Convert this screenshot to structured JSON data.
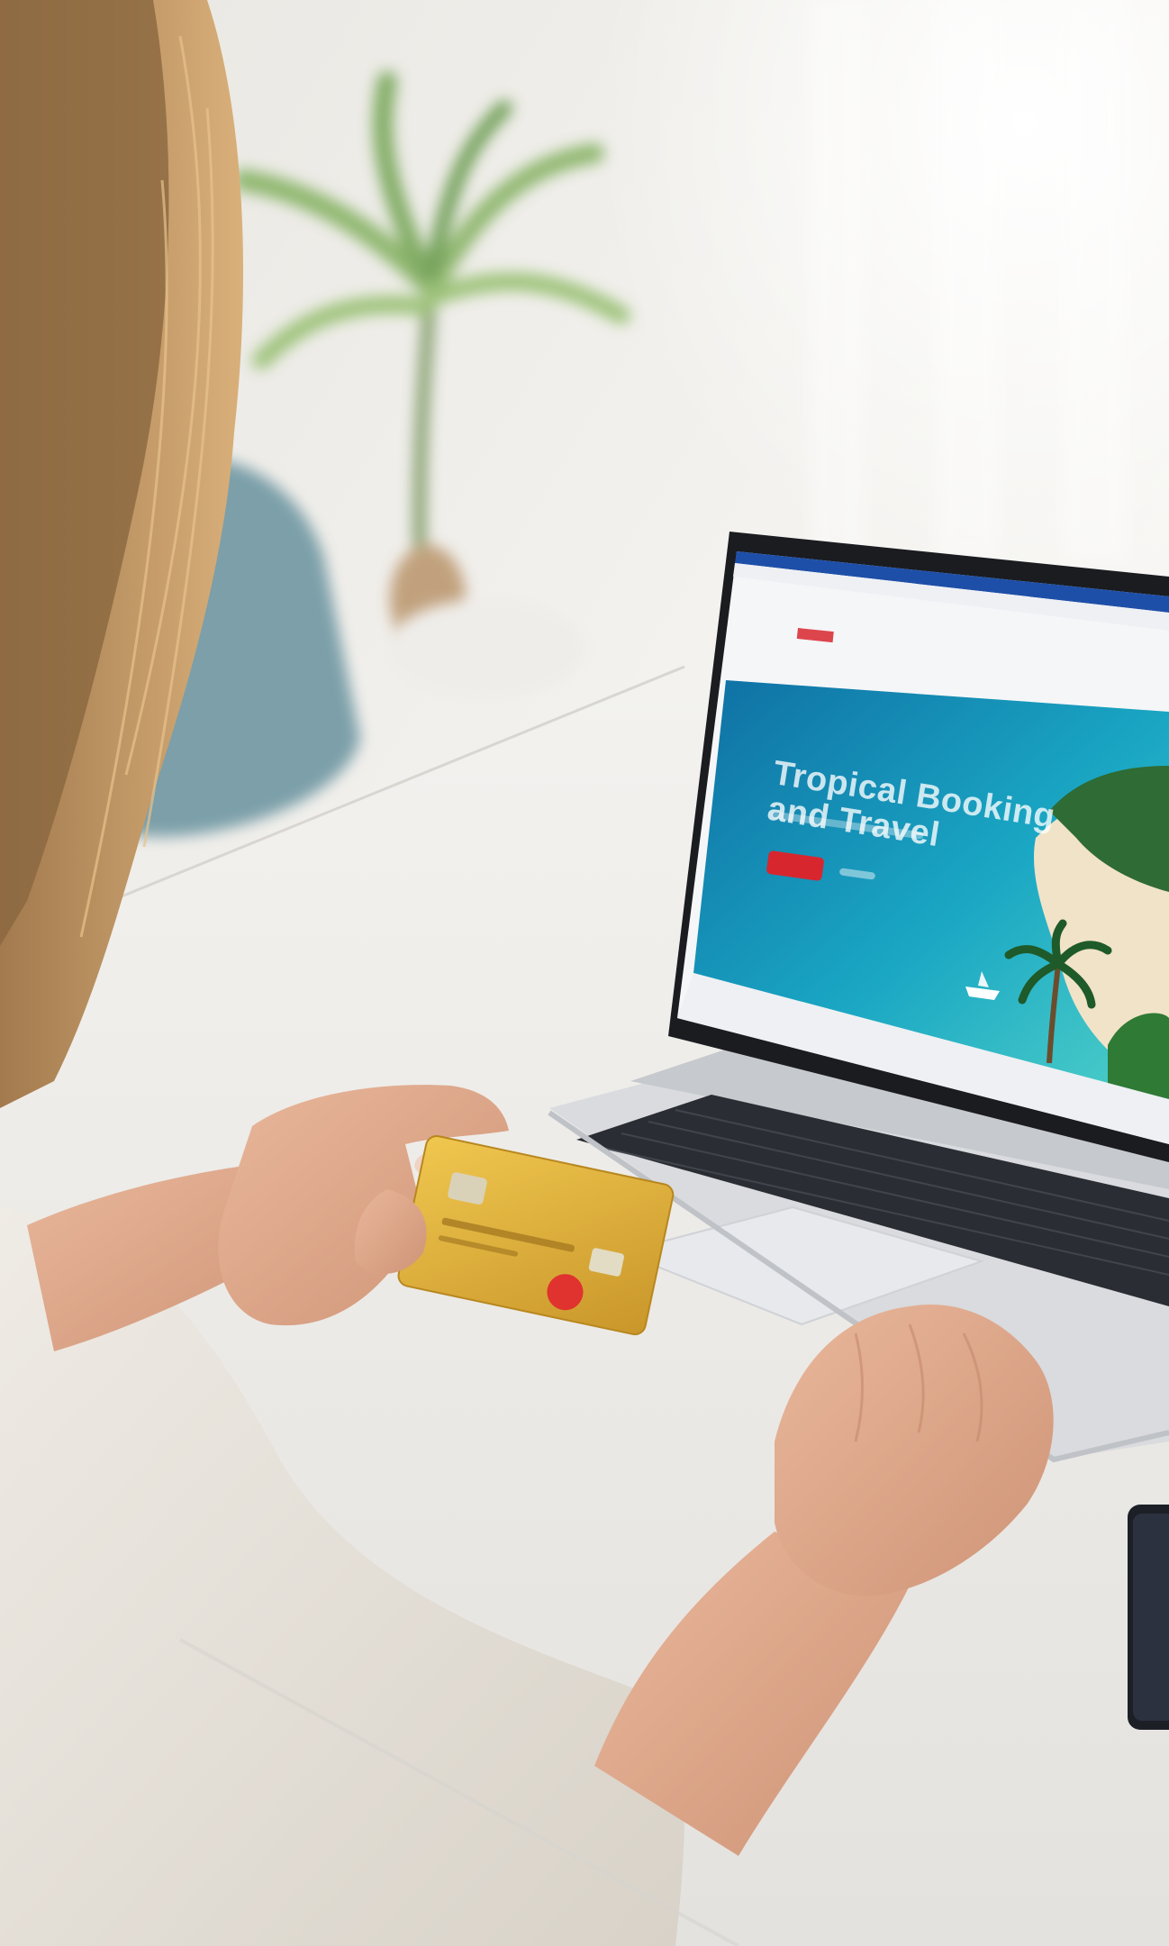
{
  "scene": {
    "description_free": true
  },
  "laptop_screen": {
    "hero_title": "Tropical Booking and Travel"
  },
  "colors": {
    "ocean": "#1aa7c4",
    "ocean_deep": "#0f6fa3",
    "sand": "#f1e3c8",
    "brand_red": "#d8262f",
    "card_gold": "#e3b33c",
    "desk": "#f4f3f0",
    "chair": "#6f97a3",
    "sweater": "#e9e4dc"
  },
  "icons": [
    "credit-card-icon",
    "palm-tree-icon",
    "boat-icon"
  ]
}
